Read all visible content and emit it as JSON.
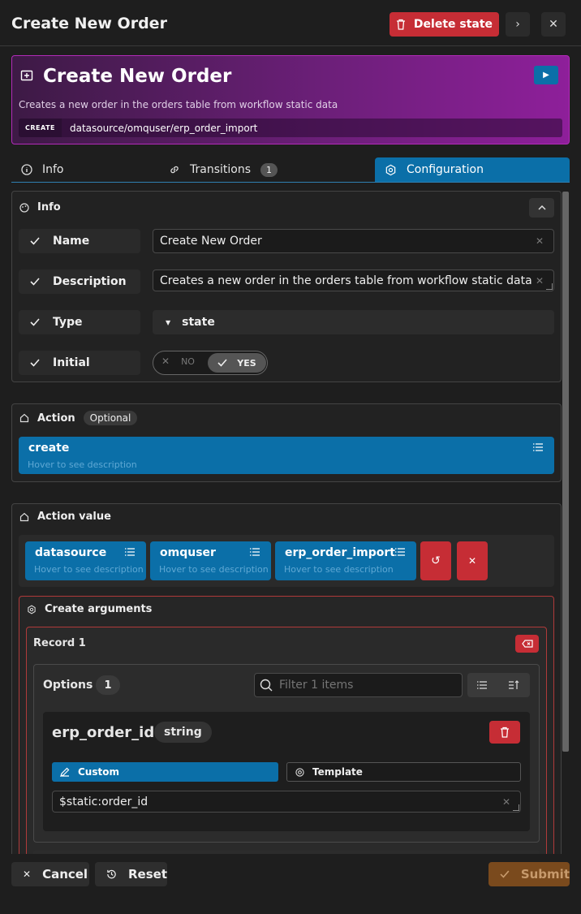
{
  "header": {
    "title": "Create New Order",
    "delete_label": "Delete state"
  },
  "banner": {
    "title": "Create New Order",
    "description": "Creates a new order in the orders table from workflow static data",
    "tag": "CREATE",
    "path": "datasource/omquser/erp_order_import"
  },
  "tabs": [
    {
      "label": "Info"
    },
    {
      "label": "Transitions",
      "count": "1"
    },
    {
      "label": "Configuration"
    }
  ],
  "info": {
    "heading": "Info",
    "rows": [
      {
        "label": "Name",
        "value": "Create New Order"
      },
      {
        "label": "Description",
        "value": "Creates a new order in the orders table from workflow static data"
      },
      {
        "label": "Type",
        "value": "state"
      },
      {
        "label": "Initial",
        "no": "NO",
        "yes": "YES"
      }
    ]
  },
  "action": {
    "heading": "Action",
    "badge": "Optional",
    "value": "create",
    "hint": "Hover to see description"
  },
  "action_value": {
    "heading": "Action value",
    "chips": [
      {
        "label": "datasource",
        "hint": "Hover to see description"
      },
      {
        "label": "omquser",
        "hint": "Hover to see description"
      },
      {
        "label": "erp_order_import",
        "hint": "Hover to see description"
      }
    ]
  },
  "create_args": {
    "heading": "Create arguments",
    "record_label": "Record 1",
    "options_label": "Options",
    "options_count": "1",
    "filter_placeholder": "Filter 1 items",
    "field_name": "erp_order_id",
    "field_type": "string",
    "mode_custom": "Custom",
    "mode_template": "Template",
    "field_value": "$static:order_id"
  },
  "footer": {
    "cancel": "Cancel",
    "reset": "Reset",
    "submit": "Submit"
  },
  "colors": {
    "accent": "#0b6fa8",
    "danger": "#c62d35",
    "banner": "#8e1f9a",
    "submit": "#7a4a1d"
  }
}
